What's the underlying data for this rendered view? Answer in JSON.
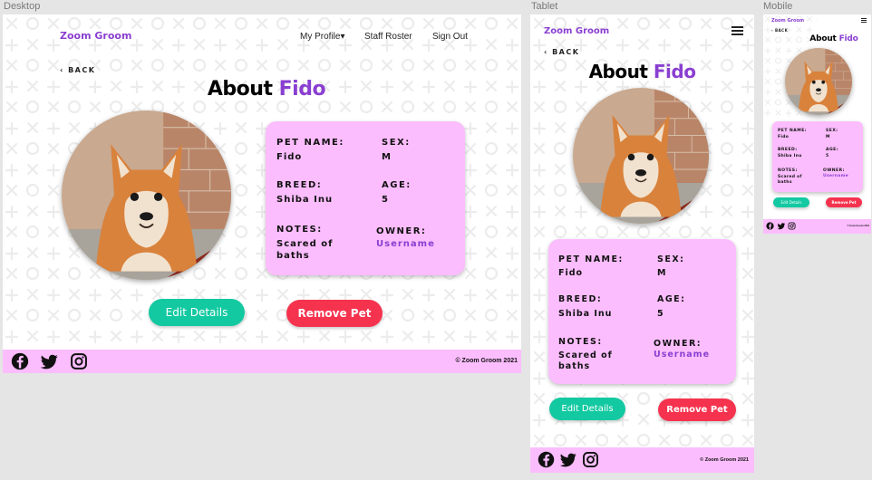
{
  "frames": {
    "desktop": "Desktop",
    "tablet": "Tablet",
    "mobile": "Mobile"
  },
  "brand": "Zoom Groom",
  "nav": {
    "my_profile": "My Profile▾",
    "staff_roster": "Staff Roster",
    "sign_out": "Sign Out"
  },
  "back": "‹ BACK",
  "title": {
    "prefix": "About ",
    "pet": "Fido"
  },
  "pet": {
    "name_label": "PET NAME:",
    "name": "Fido",
    "sex_label": "SEX:",
    "sex": "M",
    "breed_label": "BREED:",
    "breed": "Shiba Inu",
    "age_label": "AGE:",
    "age": "5",
    "notes_label": "NOTES:",
    "notes": "Scared of baths",
    "owner_label": "OWNER:",
    "owner": "Username"
  },
  "buttons": {
    "edit": "Edit Details",
    "remove": "Remove Pet"
  },
  "footer": {
    "copyright": "© Zoom Groom 2021"
  },
  "colors": {
    "brand_purple": "#8a3fd1",
    "card_pink": "#fbbdfd",
    "edit_teal": "#13c9a1",
    "remove_red": "#f5334e"
  },
  "icons": [
    "facebook-icon",
    "twitter-icon",
    "instagram-icon",
    "hamburger-menu-icon",
    "dog-photo"
  ]
}
